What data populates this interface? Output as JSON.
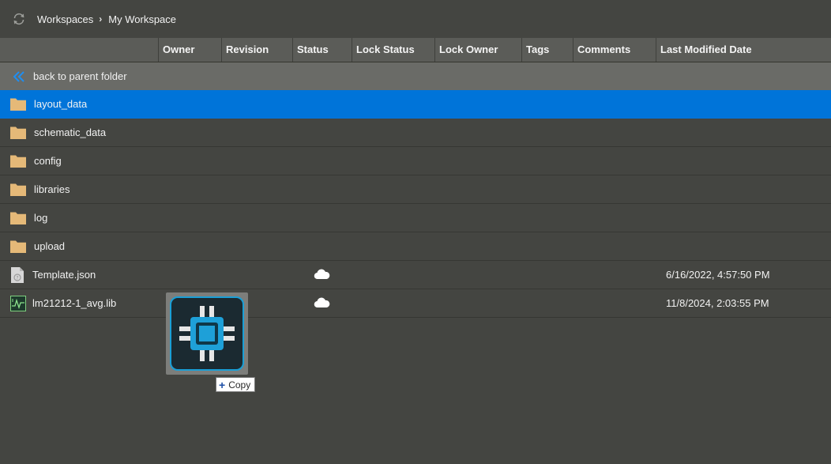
{
  "breadcrumb": {
    "root": "Workspaces",
    "current": "My Workspace"
  },
  "columns": {
    "owner": "Owner",
    "revision": "Revision",
    "status": "Status",
    "lock_status": "Lock Status",
    "lock_owner": "Lock Owner",
    "tags": "Tags",
    "comments": "Comments",
    "last_modified": "Last Modified Date"
  },
  "parent_link": "back to parent folder",
  "items": [
    {
      "name": "layout_data",
      "type": "folder",
      "icon": "folder-icon",
      "selected": true
    },
    {
      "name": "schematic_data",
      "type": "folder",
      "icon": "folder-icon"
    },
    {
      "name": "config",
      "type": "folder",
      "icon": "folder-icon"
    },
    {
      "name": "libraries",
      "type": "folder",
      "icon": "folder-icon"
    },
    {
      "name": "log",
      "type": "folder",
      "icon": "folder-icon"
    },
    {
      "name": "upload",
      "type": "folder",
      "icon": "folder-icon"
    },
    {
      "name": "Template.json",
      "type": "file",
      "icon": "unknown-file-icon",
      "status_icon": "cloud-icon",
      "last_modified": "6/16/2022, 4:57:50 PM"
    },
    {
      "name": "lm21212-1_avg.lib",
      "type": "file",
      "icon": "library-file-icon",
      "status_icon": "cloud-icon",
      "last_modified": "11/8/2024, 2:03:55 PM"
    }
  ],
  "drag": {
    "icon": "chip-icon",
    "tooltip": "Copy",
    "tooltip_icon": "plus-icon"
  },
  "colors": {
    "selection": "#0074d9",
    "background": "#444541",
    "header": "#5b5c58",
    "folder": "#e5b978"
  }
}
